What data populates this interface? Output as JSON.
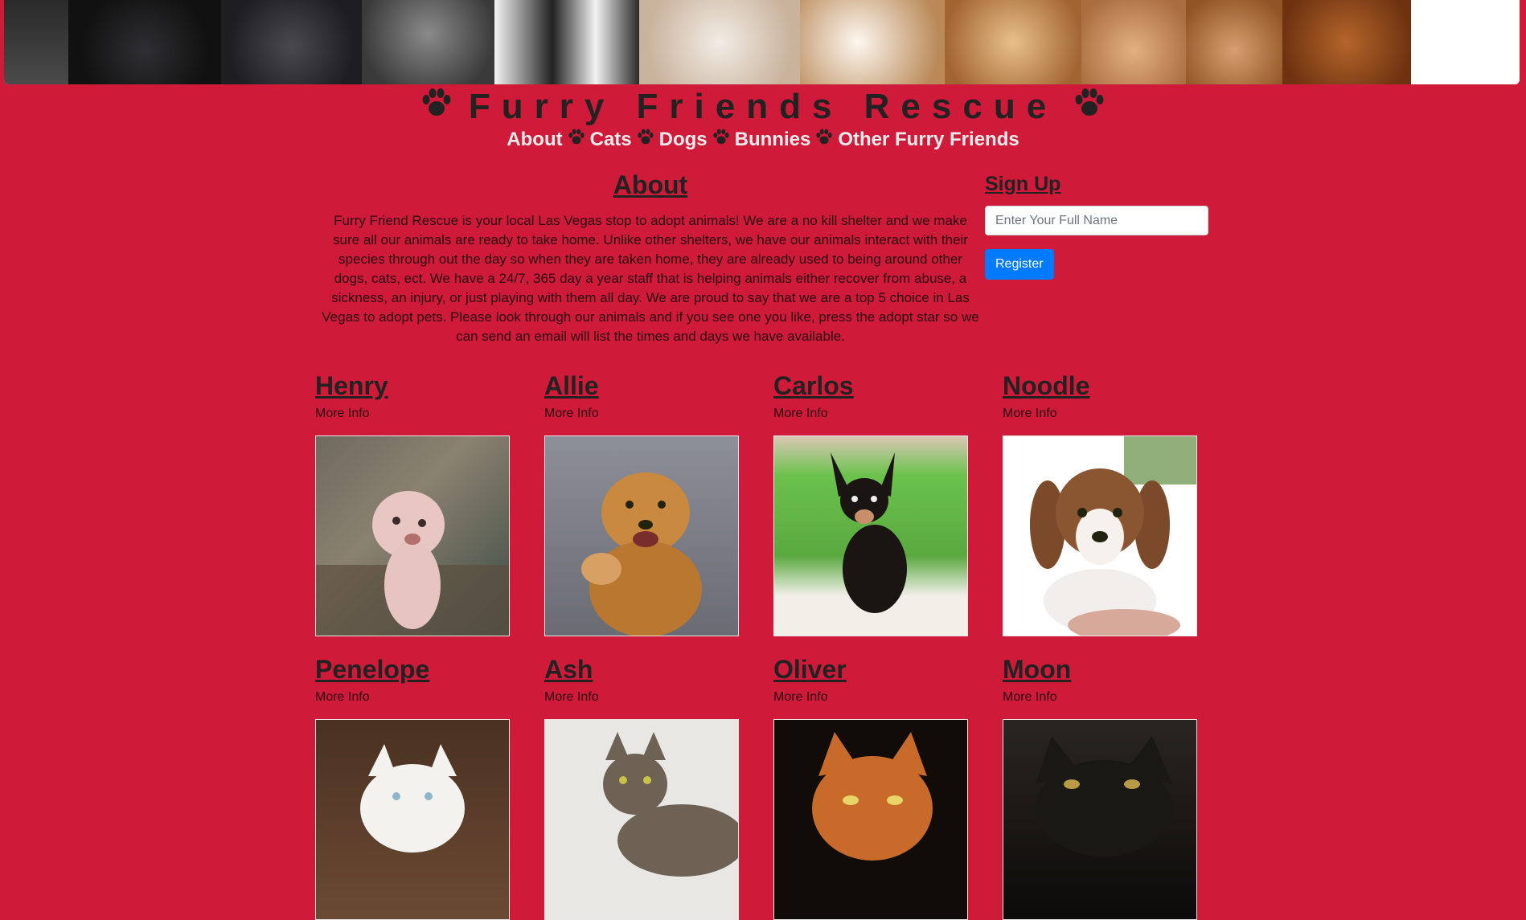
{
  "site": {
    "title": "Furry Friends Rescue"
  },
  "nav": {
    "items": [
      {
        "label": "About"
      },
      {
        "label": "Cats"
      },
      {
        "label": "Dogs"
      },
      {
        "label": "Bunnies"
      },
      {
        "label": "Other Furry Friends"
      }
    ]
  },
  "about": {
    "heading": "About",
    "body": "Furry Friend Rescue is your local Las Vegas stop to adopt animals! We are a no kill shelter and we make sure all our animals are ready to take home. Unlike other shelters, we have our animals interact with their species through out the day so when they are taken home, they are already used to being around other dogs, cats, ect. We have a 24/7, 365 day a year staff that is helping animals either recover from abuse, a sickness, an injury, or just playing with them all day. We are proud to say that we are a top 5 choice in Las Vegas to adopt pets. Please look through our animals and if you see one you like, press the adopt star so we can send an email will list the times and days we have available."
  },
  "signup": {
    "heading": "Sign Up",
    "placeholder": "Enter Your Full Name",
    "button_label": "Register"
  },
  "animals": [
    {
      "name": "Henry",
      "link": "More Info",
      "photo_colors": [
        "#6f6a5e",
        "#e8c7c3",
        "#3c4b44"
      ]
    },
    {
      "name": "Allie",
      "link": "More Info",
      "photo_colors": [
        "#8d8f99",
        "#c9893e",
        "#6a6b73"
      ]
    },
    {
      "name": "Carlos",
      "link": "More Info",
      "photo_colors": [
        "#6ac24c",
        "#1a1412",
        "#f2efe9"
      ]
    },
    {
      "name": "Noodle",
      "link": "More Info",
      "photo_colors": [
        "#ffffff",
        "#7a4a2a",
        "#f4f4f4"
      ]
    },
    {
      "name": "Penelope",
      "link": "More Info",
      "photo_colors": [
        "#4a3122",
        "#f4f2ee",
        "#6b4a33"
      ]
    },
    {
      "name": "Ash",
      "link": "More Info",
      "photo_colors": [
        "#e9e7e3",
        "#6d6254",
        "#d8d4cf"
      ]
    },
    {
      "name": "Oliver",
      "link": "More Info",
      "photo_colors": [
        "#120c09",
        "#c76a2a",
        "#2a1810"
      ]
    },
    {
      "name": "Moon",
      "link": "More Info",
      "photo_colors": [
        "#1a1814",
        "#0c0b09",
        "#b89a47"
      ]
    }
  ],
  "colors": {
    "background": "#cf1a39",
    "accent": "#007bff"
  }
}
